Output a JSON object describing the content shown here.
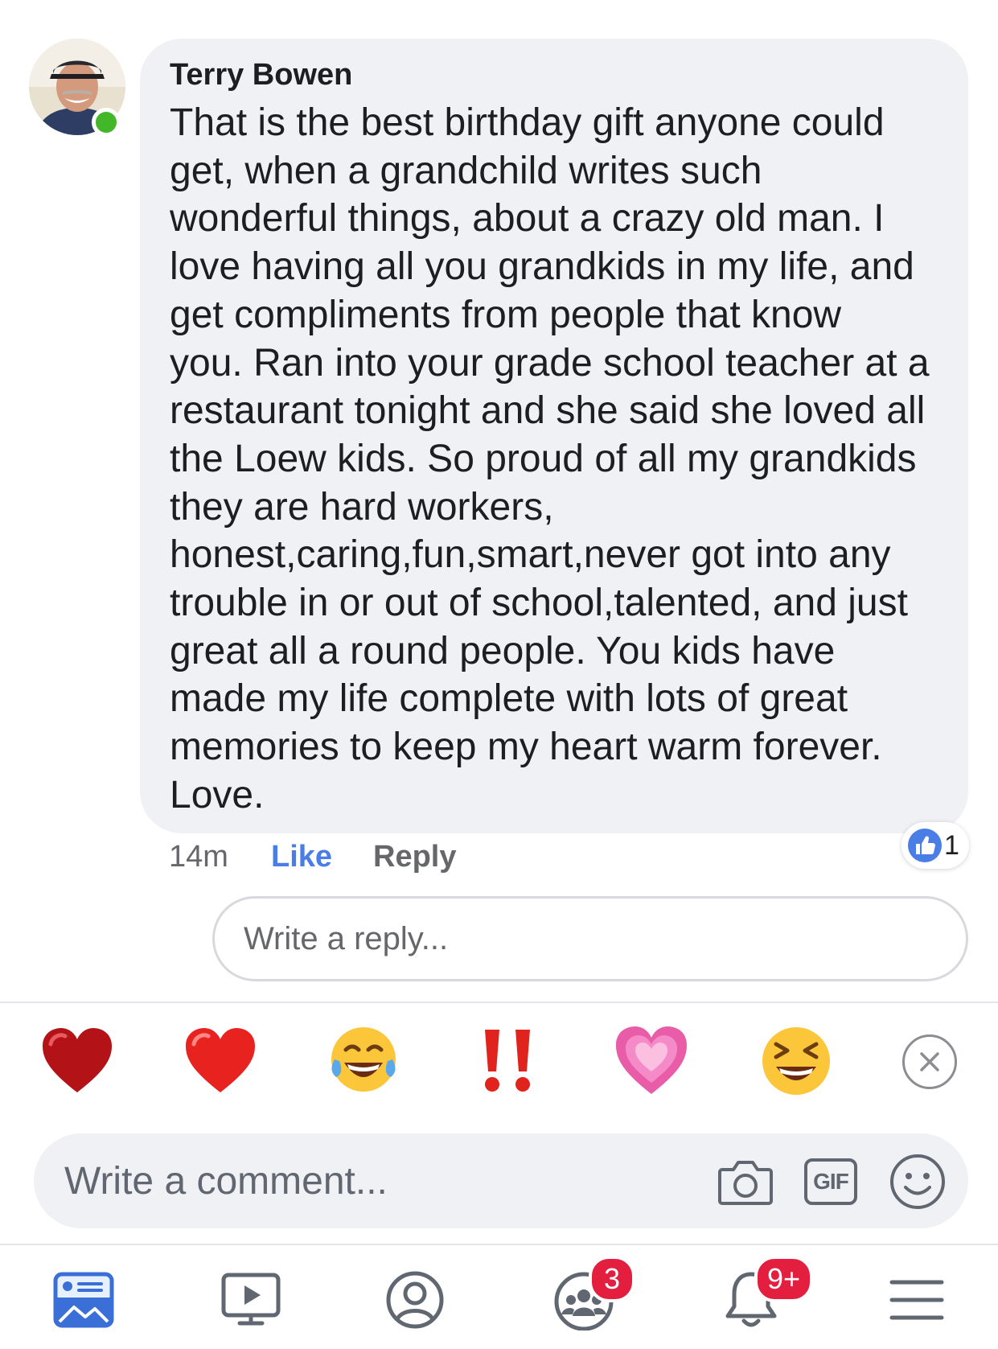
{
  "comment": {
    "author": "Terry Bowen",
    "body_lines": [
      "That is the best birthday gift anyone could",
      "get, when a grandchild writes such",
      "wonderful things, about a crazy old man. I",
      "love having all you grandkids in my life, and",
      "get compliments from people that know",
      "you. Ran into your grade school teacher at a",
      "restaurant tonight and she said she loved all",
      "the Loew kids. So proud of all my grandkids",
      "they are hard workers,",
      "honest,caring,fun,smart,never got into any",
      "trouble in or out of school,talented, and just",
      "great all a round people. You kids have",
      "made my life complete with lots of great",
      "memories to keep my heart warm forever.",
      "Love."
    ],
    "timestamp": "14m",
    "like_label": "Like",
    "reply_label": "Reply",
    "reaction_count": "1",
    "online": true
  },
  "reply_box": {
    "placeholder": "Write a reply..."
  },
  "emoji_bar": {
    "items": [
      "dark-red-heart",
      "red-heart",
      "tears-of-joy",
      "double-exclamation",
      "growing-heart",
      "squinting-laugh"
    ],
    "close_icon": "close-icon"
  },
  "composer": {
    "placeholder": "Write a comment...",
    "gif_label": "GIF",
    "icons": [
      "camera-icon",
      "gif-icon",
      "smiley-icon"
    ]
  },
  "bottom_nav": {
    "items": [
      {
        "name": "news-feed",
        "icon": "news-feed-icon",
        "active": true
      },
      {
        "name": "watch",
        "icon": "video-icon"
      },
      {
        "name": "profile",
        "icon": "profile-icon"
      },
      {
        "name": "groups",
        "icon": "groups-icon",
        "badge": "3"
      },
      {
        "name": "notifications",
        "icon": "bell-icon",
        "badge": "9+"
      },
      {
        "name": "menu",
        "icon": "menu-icon"
      }
    ]
  },
  "colors": {
    "accent": "#4a7ee6",
    "bubble": "#f0f1f4",
    "online": "#42b72a",
    "badge": "#e41e3f",
    "meta_text": "#65676b"
  }
}
